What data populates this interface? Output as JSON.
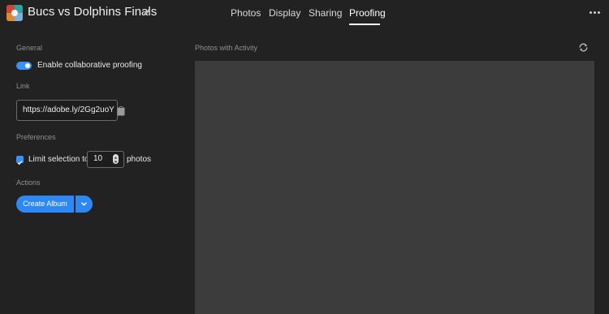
{
  "header": {
    "album_title": "Bucs vs Dolphins Finals",
    "edit_icon": "pencil-icon",
    "tabs": [
      {
        "label": "Photos",
        "active": false
      },
      {
        "label": "Display",
        "active": false
      },
      {
        "label": "Sharing",
        "active": false
      },
      {
        "label": "Proofing",
        "active": true
      }
    ],
    "more_icon": "more-horizontal-icon"
  },
  "sidebar": {
    "general": {
      "label": "General",
      "toggle_label": "Enable collaborative proofing",
      "toggle_on": true
    },
    "link": {
      "label": "Link",
      "value": "https://adobe.ly/2Gg2uoY",
      "copy_icon": "clipboard-icon"
    },
    "preferences": {
      "label": "Preferences",
      "limit_checked": true,
      "limit_prefix": "Limit selection to",
      "limit_value": "10",
      "limit_suffix": "photos"
    },
    "actions": {
      "label": "Actions",
      "create_album": "Create Album",
      "dropdown_icon": "chevron-down-icon"
    }
  },
  "main": {
    "title": "Photos with Activity",
    "refresh_icon": "refresh-icon"
  },
  "colors": {
    "accent": "#2d88f3",
    "background": "#222222",
    "panel": "#3c3c3c"
  }
}
